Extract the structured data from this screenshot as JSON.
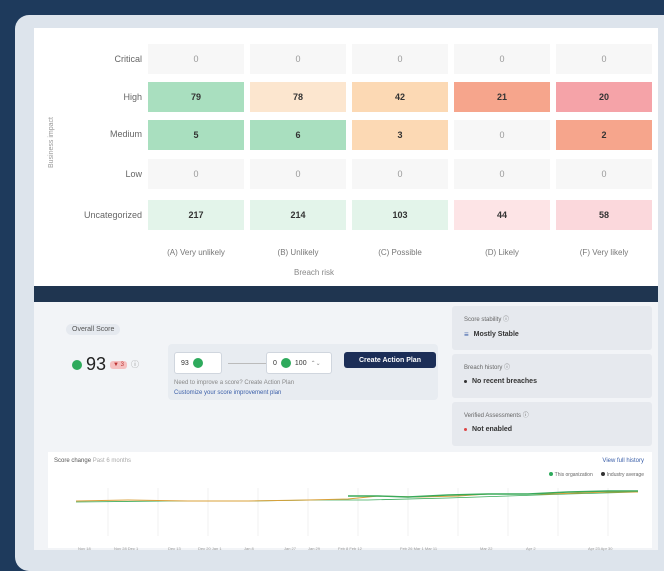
{
  "matrix": {
    "y_axis_label": "Business impact",
    "x_axis_label": "Breach risk",
    "rows": [
      {
        "label": "Critical",
        "cells": [
          "0",
          "0",
          "0",
          "0",
          "0"
        ]
      },
      {
        "label": "High",
        "cells": [
          "79",
          "78",
          "42",
          "21",
          "20"
        ]
      },
      {
        "label": "Medium",
        "cells": [
          "5",
          "6",
          "3",
          "0",
          "2"
        ]
      },
      {
        "label": "Low",
        "cells": [
          "0",
          "0",
          "0",
          "0",
          "0"
        ]
      },
      {
        "label": "Uncategorized",
        "cells": [
          "217",
          "214",
          "103",
          "44",
          "58"
        ]
      }
    ],
    "columns": [
      "(A) Very unlikely",
      "(B) Unlikely",
      "(C) Possible",
      "(D) Likely",
      "(F) Very likely"
    ],
    "colors": {
      "green_dark": "#a9dfbf",
      "green_light": "#e3f4ea",
      "orange_light": "#fcd9b4",
      "orange_pale": "#fce6cf",
      "red": "#f6a58c",
      "pink": "#f5a3a8",
      "pink_light": "#fde4e6",
      "pink_pale": "#fbd8dc"
    }
  },
  "score": {
    "tag": "Overall Score",
    "value": "93",
    "badge": "▼ 3",
    "current_label": "93",
    "target_left": "0",
    "target_value": "100",
    "create_button": "Create Action Plan",
    "hint": "Need to improve a score? Create Action Plan",
    "link": "Customize your score improvement plan"
  },
  "side": [
    {
      "title": "Score stability ⓘ",
      "value": "Mostly Stable"
    },
    {
      "title": "Breach history ⓘ",
      "value": "No recent breaches"
    },
    {
      "title": "Verified Assessments ⓘ",
      "value": "Not enabled"
    }
  ],
  "chart": {
    "title": "Score change",
    "subtitle": "Past 6 months",
    "view_all": "View full history",
    "legend": [
      "This organization",
      "Industry average"
    ],
    "x_ticks": [
      "Nov 18",
      "Nov 28 Dec 1",
      "Dec 13",
      "Dec 20 Jan 1",
      "Jan 8",
      "Jan 27",
      "Jan 29",
      "Feb 8 Feb 12",
      "Feb 26 Mar 1 Mar 11",
      "Mar 22",
      "Apr 2",
      "Apr 23 Apr 30"
    ]
  }
}
